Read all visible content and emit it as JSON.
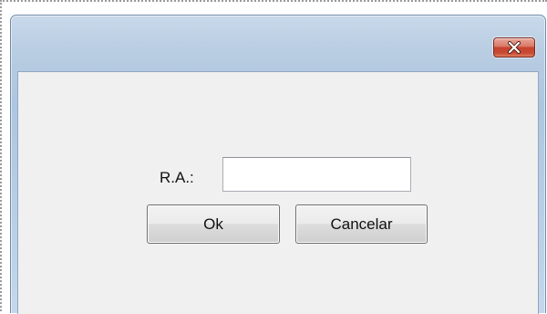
{
  "dialog": {
    "close_icon": "close-icon",
    "ra_label": "R.A.:",
    "ra_value": "",
    "ok_label": "Ok",
    "cancel_label": "Cancelar"
  },
  "colors": {
    "frame": "#b9cde2",
    "client_background": "#f0f0f0",
    "close_button": "#c5432d"
  }
}
